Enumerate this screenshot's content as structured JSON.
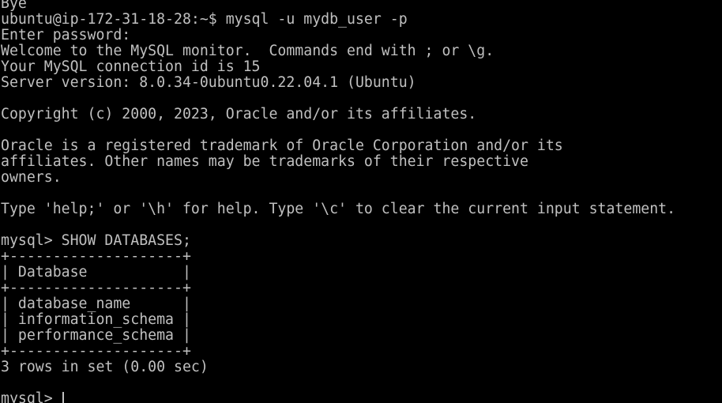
{
  "terminal": {
    "colors": {
      "background": "#000000",
      "foreground": "#c0c0c0"
    },
    "prev_output": "Bye",
    "session_prompt": "ubuntu@ip-172-31-18-28:~$ mysql -u mydb_user -p",
    "password_prompt": "Enter password:",
    "welcome": "Welcome to the MySQL monitor.  Commands end with ; or \\g.",
    "connection_id": "Your MySQL connection id is 15",
    "server_version": "Server version: 8.0.34-0ubuntu0.22.04.1 (Ubuntu)",
    "copyright": "Copyright (c) 2000, 2023, Oracle and/or its affiliates.",
    "trademark": [
      "Oracle is a registered trademark of Oracle Corporation and/or its",
      "affiliates. Other names may be trademarks of their respective",
      "owners."
    ],
    "help_hint": "Type 'help;' or '\\h' for help. Type '\\c' to clear the current input statement.",
    "query": "mysql> SHOW DATABASES;",
    "table": {
      "border": "+--------------------+",
      "header": "| Database           |",
      "rows": [
        "| database_name      |",
        "| information_schema |",
        "| performance_schema |"
      ]
    },
    "result_summary": "3 rows in set (0.00 sec)",
    "prompt": "mysql> "
  }
}
